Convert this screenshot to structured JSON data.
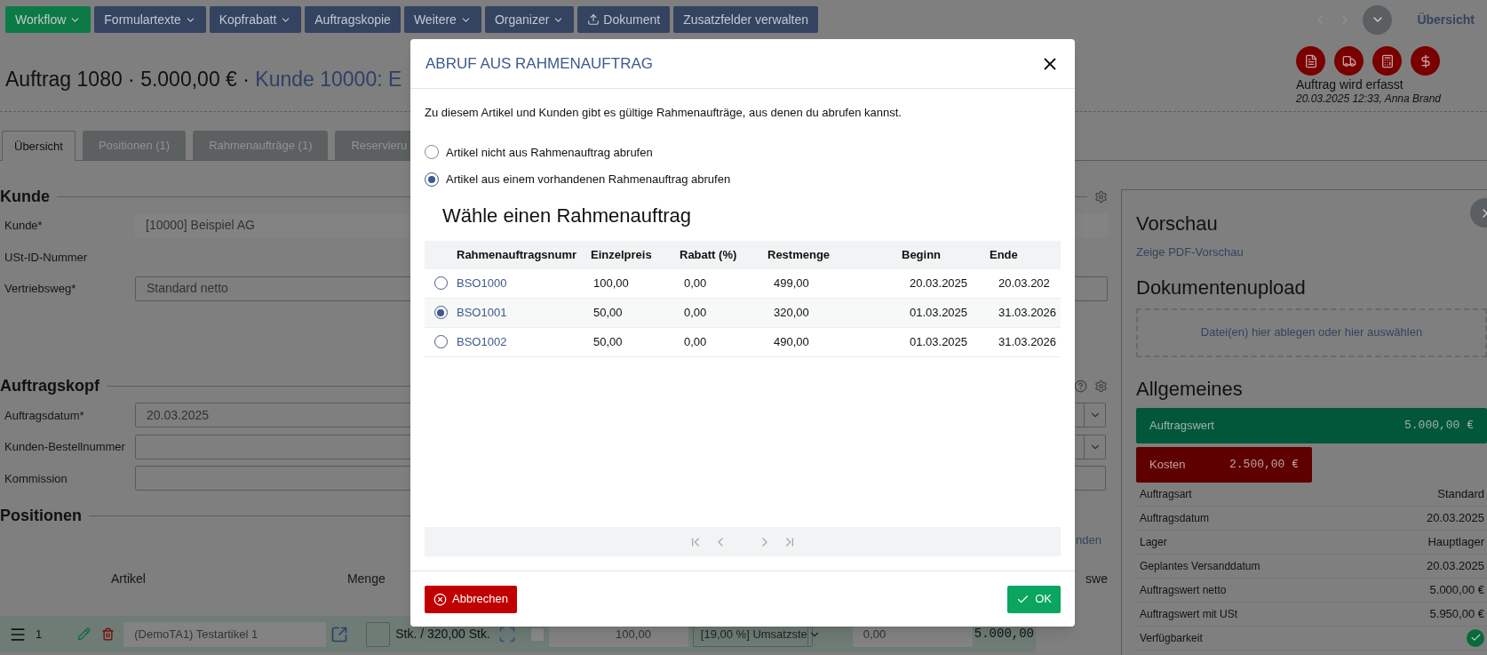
{
  "toolbar": {
    "buttons": [
      {
        "label": "Workflow",
        "kind": "dropdown",
        "color": "#0b7a45"
      },
      {
        "label": "Formulartexte",
        "kind": "dropdown",
        "color": "#34435f"
      },
      {
        "label": "Kopfrabatt",
        "kind": "dropdown",
        "color": "#34435f"
      },
      {
        "label": "Auftragskopie",
        "kind": "plain",
        "color": "#34435f"
      },
      {
        "label": "Weitere",
        "kind": "dropdown",
        "color": "#34435f"
      },
      {
        "label": "Organizer",
        "kind": "dropdown",
        "color": "#34435f"
      },
      {
        "label": "Dokument",
        "kind": "upload",
        "color": "#34435f"
      },
      {
        "label": "Zusatzfelder verwalten",
        "kind": "plain",
        "color": "#34435f"
      }
    ],
    "nav_link": "Übersicht"
  },
  "header": {
    "title": "Auftrag 1080 · 5.000,00 € · ",
    "customer": "Kunde 10000: E",
    "status": "Auftrag wird erfasst",
    "meta": "20.03.2025 12:33, Anna Brand"
  },
  "tabs": [
    {
      "label": "Übersicht",
      "selected": true
    },
    {
      "label": "Positionen (1)",
      "selected": false
    },
    {
      "label": "Rahmenaufträge (1)",
      "selected": false
    },
    {
      "label": "Reservieru",
      "selected": false
    }
  ],
  "customer_section": {
    "title": "Kunde",
    "fields": [
      {
        "label": "Kunde*",
        "kind": "readonly",
        "value": "[10000] Beispiel AG"
      },
      {
        "label": "USt-ID-Nummer",
        "kind": "text"
      },
      {
        "label": "Vertriebsweg*",
        "kind": "input",
        "value": "Standard netto"
      }
    ]
  },
  "order_section": {
    "title": "Auftragskopf",
    "fields": [
      {
        "label": "Auftragsdatum*",
        "kind": "select",
        "value": "20.03.2025"
      },
      {
        "label": "Kunden-Bestellnummer",
        "kind": "select"
      },
      {
        "label": "Kommission",
        "kind": "input"
      }
    ]
  },
  "positions": {
    "title": "Positionen",
    "link": "nden",
    "columns": [
      "Artikel",
      "Menge",
      "swe"
    ],
    "rows": [
      {
        "index": "1",
        "article": "(DemoTA1) Testartikel 1",
        "quantity": "Stk. / 320,00 Stk.",
        "price": "100,00",
        "tax": "[19,00 %] Umsatzste",
        "discount": "0,00",
        "total": "5.000,00"
      }
    ]
  },
  "sidebar": {
    "preview_title": "Vorschau",
    "preview_link": "Zeige PDF-Vorschau",
    "upload_title": "Dokumentenupload",
    "upload_hint": "Datei(en) hier ablegen oder hier auswählen",
    "general_title": "Allgemeines",
    "value_bar": {
      "label": "Auftragswert",
      "value": "5.000,00 €"
    },
    "cost_bar": {
      "label": "Kosten",
      "value": "2.500,00 €"
    },
    "facts": [
      {
        "label": "Auftragsart",
        "kind": "text",
        "value": "Standard"
      },
      {
        "label": "Auftragsdatum",
        "kind": "text",
        "value": "20.03.2025"
      },
      {
        "label": "Lager",
        "kind": "text",
        "value": "Hauptlager"
      },
      {
        "label": "Geplantes Versanddatum",
        "kind": "text",
        "value": "20.03.2025"
      },
      {
        "label": "Auftragswert netto",
        "kind": "text",
        "value": "5.000,00 €"
      },
      {
        "label": "Auftragswert mit USt",
        "kind": "text",
        "value": "5.950,00 €"
      },
      {
        "label": "Verfügbarkeit",
        "kind": "check"
      }
    ]
  },
  "modal": {
    "title": "ABRUF AUS RAHMENAUFTRAG",
    "intro": "Zu diesem Artikel und Kunden gibt es gültige Rahmenaufträge, aus denen du abrufen kannst.",
    "options": [
      {
        "label": "Artikel nicht aus Rahmenauftrag abrufen",
        "selected": false
      },
      {
        "label": "Artikel aus einem vorhandenen Rahmenauftrag abrufen",
        "selected": true
      }
    ],
    "table_title": "Wähle einen Rahmenauftrag",
    "columns": [
      "Rahmenauftragsnumr",
      "Einzelpreis",
      "Rabatt (%)",
      "Restmenge",
      "Beginn",
      "Ende"
    ],
    "rows": [
      {
        "number": "BSO1000",
        "price": "100,00",
        "discount": "0,00",
        "remaining": "499,00",
        "start": "20.03.2025",
        "end": "20.03.202",
        "selected": false
      },
      {
        "number": "BSO1001",
        "price": "50,00",
        "discount": "0,00",
        "remaining": "320,00",
        "start": "01.03.2025",
        "end": "31.03.2026",
        "selected": true
      },
      {
        "number": "BSO1002",
        "price": "50,00",
        "discount": "0,00",
        "remaining": "490,00",
        "start": "01.03.2025",
        "end": "31.03.2026",
        "selected": false
      }
    ],
    "cancel": "Abbrechen",
    "ok": "OK"
  }
}
